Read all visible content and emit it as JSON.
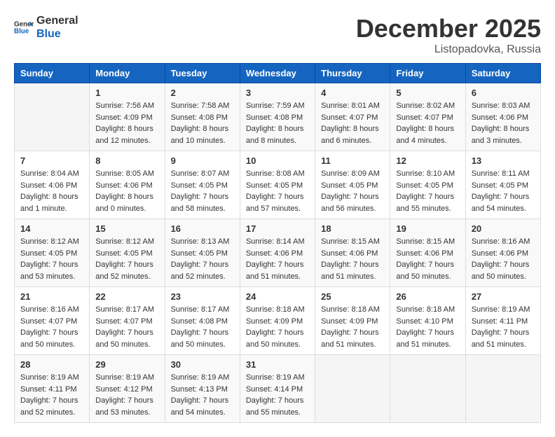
{
  "header": {
    "logo_line1": "General",
    "logo_line2": "Blue",
    "month_year": "December 2025",
    "location": "Listopadovka, Russia"
  },
  "days_of_week": [
    "Sunday",
    "Monday",
    "Tuesday",
    "Wednesday",
    "Thursday",
    "Friday",
    "Saturday"
  ],
  "weeks": [
    [
      {
        "day": "",
        "sunrise": "",
        "sunset": "",
        "daylight": "",
        "empty": true
      },
      {
        "day": "1",
        "sunrise": "7:56 AM",
        "sunset": "4:09 PM",
        "daylight": "8 hours and 12 minutes.",
        "empty": false
      },
      {
        "day": "2",
        "sunrise": "7:58 AM",
        "sunset": "4:08 PM",
        "daylight": "8 hours and 10 minutes.",
        "empty": false
      },
      {
        "day": "3",
        "sunrise": "7:59 AM",
        "sunset": "4:08 PM",
        "daylight": "8 hours and 8 minutes.",
        "empty": false
      },
      {
        "day": "4",
        "sunrise": "8:01 AM",
        "sunset": "4:07 PM",
        "daylight": "8 hours and 6 minutes.",
        "empty": false
      },
      {
        "day": "5",
        "sunrise": "8:02 AM",
        "sunset": "4:07 PM",
        "daylight": "8 hours and 4 minutes.",
        "empty": false
      },
      {
        "day": "6",
        "sunrise": "8:03 AM",
        "sunset": "4:06 PM",
        "daylight": "8 hours and 3 minutes.",
        "empty": false
      }
    ],
    [
      {
        "day": "7",
        "sunrise": "8:04 AM",
        "sunset": "4:06 PM",
        "daylight": "8 hours and 1 minute.",
        "empty": false
      },
      {
        "day": "8",
        "sunrise": "8:05 AM",
        "sunset": "4:06 PM",
        "daylight": "8 hours and 0 minutes.",
        "empty": false
      },
      {
        "day": "9",
        "sunrise": "8:07 AM",
        "sunset": "4:05 PM",
        "daylight": "7 hours and 58 minutes.",
        "empty": false
      },
      {
        "day": "10",
        "sunrise": "8:08 AM",
        "sunset": "4:05 PM",
        "daylight": "7 hours and 57 minutes.",
        "empty": false
      },
      {
        "day": "11",
        "sunrise": "8:09 AM",
        "sunset": "4:05 PM",
        "daylight": "7 hours and 56 minutes.",
        "empty": false
      },
      {
        "day": "12",
        "sunrise": "8:10 AM",
        "sunset": "4:05 PM",
        "daylight": "7 hours and 55 minutes.",
        "empty": false
      },
      {
        "day": "13",
        "sunrise": "8:11 AM",
        "sunset": "4:05 PM",
        "daylight": "7 hours and 54 minutes.",
        "empty": false
      }
    ],
    [
      {
        "day": "14",
        "sunrise": "8:12 AM",
        "sunset": "4:05 PM",
        "daylight": "7 hours and 53 minutes.",
        "empty": false
      },
      {
        "day": "15",
        "sunrise": "8:12 AM",
        "sunset": "4:05 PM",
        "daylight": "7 hours and 52 minutes.",
        "empty": false
      },
      {
        "day": "16",
        "sunrise": "8:13 AM",
        "sunset": "4:05 PM",
        "daylight": "7 hours and 52 minutes.",
        "empty": false
      },
      {
        "day": "17",
        "sunrise": "8:14 AM",
        "sunset": "4:06 PM",
        "daylight": "7 hours and 51 minutes.",
        "empty": false
      },
      {
        "day": "18",
        "sunrise": "8:15 AM",
        "sunset": "4:06 PM",
        "daylight": "7 hours and 51 minutes.",
        "empty": false
      },
      {
        "day": "19",
        "sunrise": "8:15 AM",
        "sunset": "4:06 PM",
        "daylight": "7 hours and 50 minutes.",
        "empty": false
      },
      {
        "day": "20",
        "sunrise": "8:16 AM",
        "sunset": "4:06 PM",
        "daylight": "7 hours and 50 minutes.",
        "empty": false
      }
    ],
    [
      {
        "day": "21",
        "sunrise": "8:16 AM",
        "sunset": "4:07 PM",
        "daylight": "7 hours and 50 minutes.",
        "empty": false
      },
      {
        "day": "22",
        "sunrise": "8:17 AM",
        "sunset": "4:07 PM",
        "daylight": "7 hours and 50 minutes.",
        "empty": false
      },
      {
        "day": "23",
        "sunrise": "8:17 AM",
        "sunset": "4:08 PM",
        "daylight": "7 hours and 50 minutes.",
        "empty": false
      },
      {
        "day": "24",
        "sunrise": "8:18 AM",
        "sunset": "4:09 PM",
        "daylight": "7 hours and 50 minutes.",
        "empty": false
      },
      {
        "day": "25",
        "sunrise": "8:18 AM",
        "sunset": "4:09 PM",
        "daylight": "7 hours and 51 minutes.",
        "empty": false
      },
      {
        "day": "26",
        "sunrise": "8:18 AM",
        "sunset": "4:10 PM",
        "daylight": "7 hours and 51 minutes.",
        "empty": false
      },
      {
        "day": "27",
        "sunrise": "8:19 AM",
        "sunset": "4:11 PM",
        "daylight": "7 hours and 51 minutes.",
        "empty": false
      }
    ],
    [
      {
        "day": "28",
        "sunrise": "8:19 AM",
        "sunset": "4:11 PM",
        "daylight": "7 hours and 52 minutes.",
        "empty": false
      },
      {
        "day": "29",
        "sunrise": "8:19 AM",
        "sunset": "4:12 PM",
        "daylight": "7 hours and 53 minutes.",
        "empty": false
      },
      {
        "day": "30",
        "sunrise": "8:19 AM",
        "sunset": "4:13 PM",
        "daylight": "7 hours and 54 minutes.",
        "empty": false
      },
      {
        "day": "31",
        "sunrise": "8:19 AM",
        "sunset": "4:14 PM",
        "daylight": "7 hours and 55 minutes.",
        "empty": false
      },
      {
        "day": "",
        "sunrise": "",
        "sunset": "",
        "daylight": "",
        "empty": true
      },
      {
        "day": "",
        "sunrise": "",
        "sunset": "",
        "daylight": "",
        "empty": true
      },
      {
        "day": "",
        "sunrise": "",
        "sunset": "",
        "daylight": "",
        "empty": true
      }
    ]
  ]
}
